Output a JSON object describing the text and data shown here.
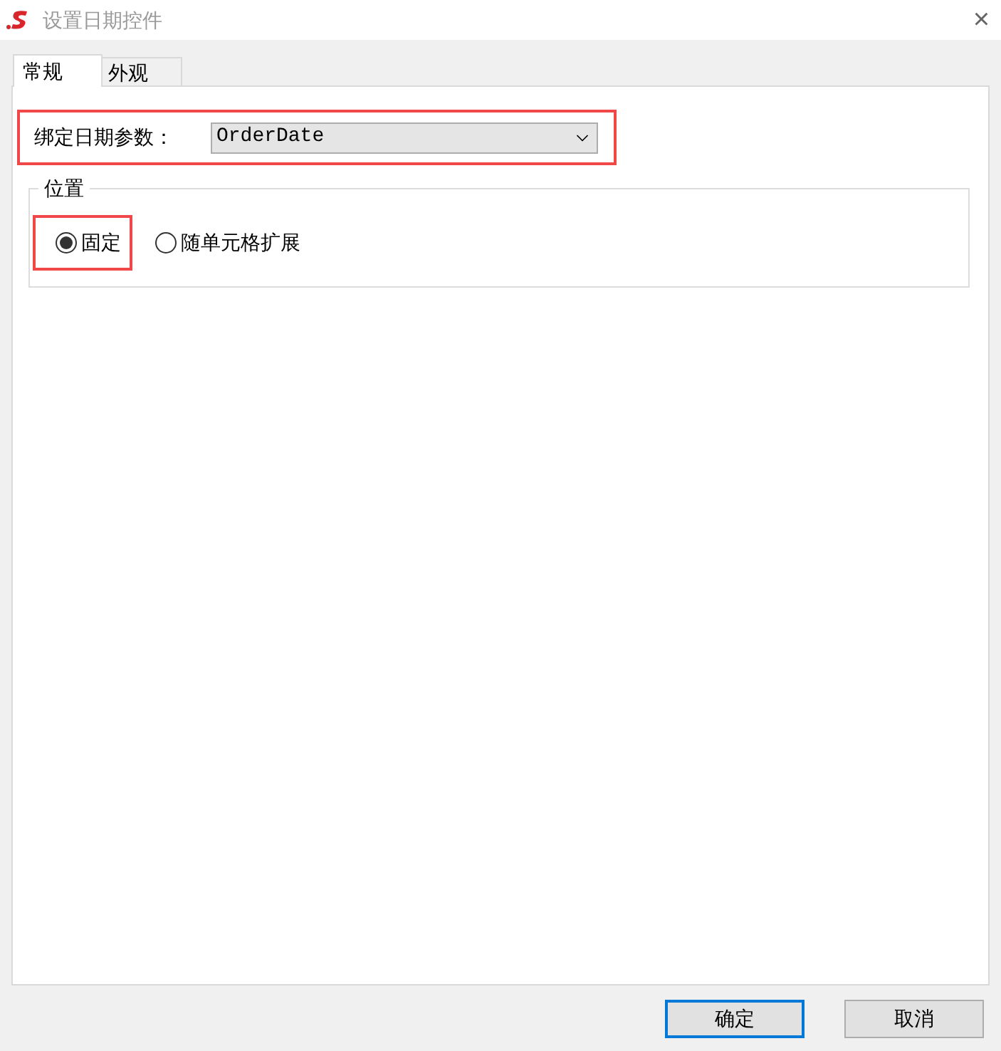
{
  "window": {
    "title": "设置日期控件",
    "close": "×"
  },
  "tabs": [
    {
      "label": "常规",
      "selected": true
    },
    {
      "label": "外观",
      "selected": false
    }
  ],
  "bind_field": {
    "label": "绑定日期参数：",
    "value": "OrderDate",
    "highlighted": true
  },
  "position": {
    "legend": "位置",
    "options": [
      {
        "label": "固定",
        "selected": true,
        "highlighted": true
      },
      {
        "label": "随单元格扩展",
        "selected": false,
        "highlighted": false
      }
    ]
  },
  "buttons": [
    {
      "label": "确定",
      "default": true
    },
    {
      "label": "取消",
      "default": false
    }
  ]
}
